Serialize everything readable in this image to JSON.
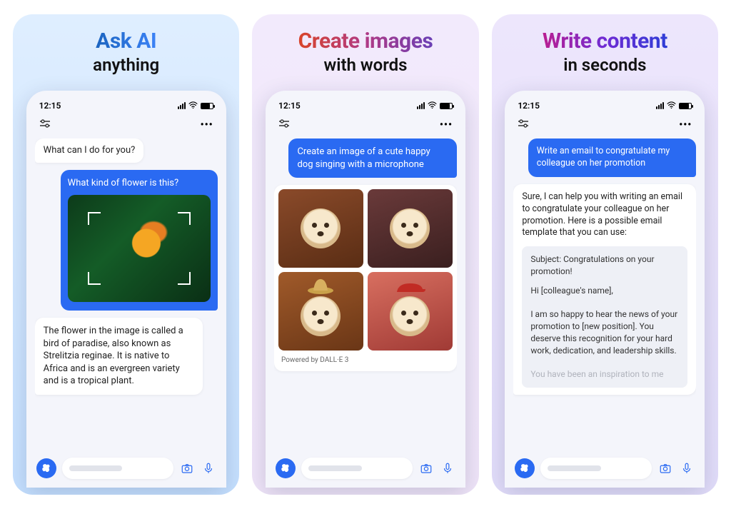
{
  "panels": [
    {
      "headline": "Ask AI",
      "subhead": "anything",
      "time": "12:15",
      "ai_greeting": "What can I do for you?",
      "user_prompt": "What kind of flower is this?",
      "ai_answer": "The flower in the image is called a bird of paradise, also known as Strelitzia reginae. It is native to Africa and is an evergreen variety and is a tropical plant."
    },
    {
      "headline": "Create images",
      "subhead": "with words",
      "time": "12:15",
      "user_prompt": "Create an image of a cute happy dog singing with a microphone",
      "powered": "Powered by DALL·E 3"
    },
    {
      "headline": "Write content",
      "subhead": "in seconds",
      "time": "12:15",
      "user_prompt": "Write an email to congratulate my colleague on her promotion",
      "ai_intro": "Sure, I can help you with writing an email to congratulate your colleague on her promotion. Here is a possible email template that you can use:",
      "email_subject": "Subject: Congratulations on your promotion!",
      "email_greeting": "Hi [colleague's name],",
      "email_body": "I am so happy to hear the news of your promotion to [new position]. You deserve this recognition for your hard work, dedication, and leadership skills.",
      "email_fade": "You have been an inspiration to me"
    }
  ],
  "more_dots": "•••"
}
